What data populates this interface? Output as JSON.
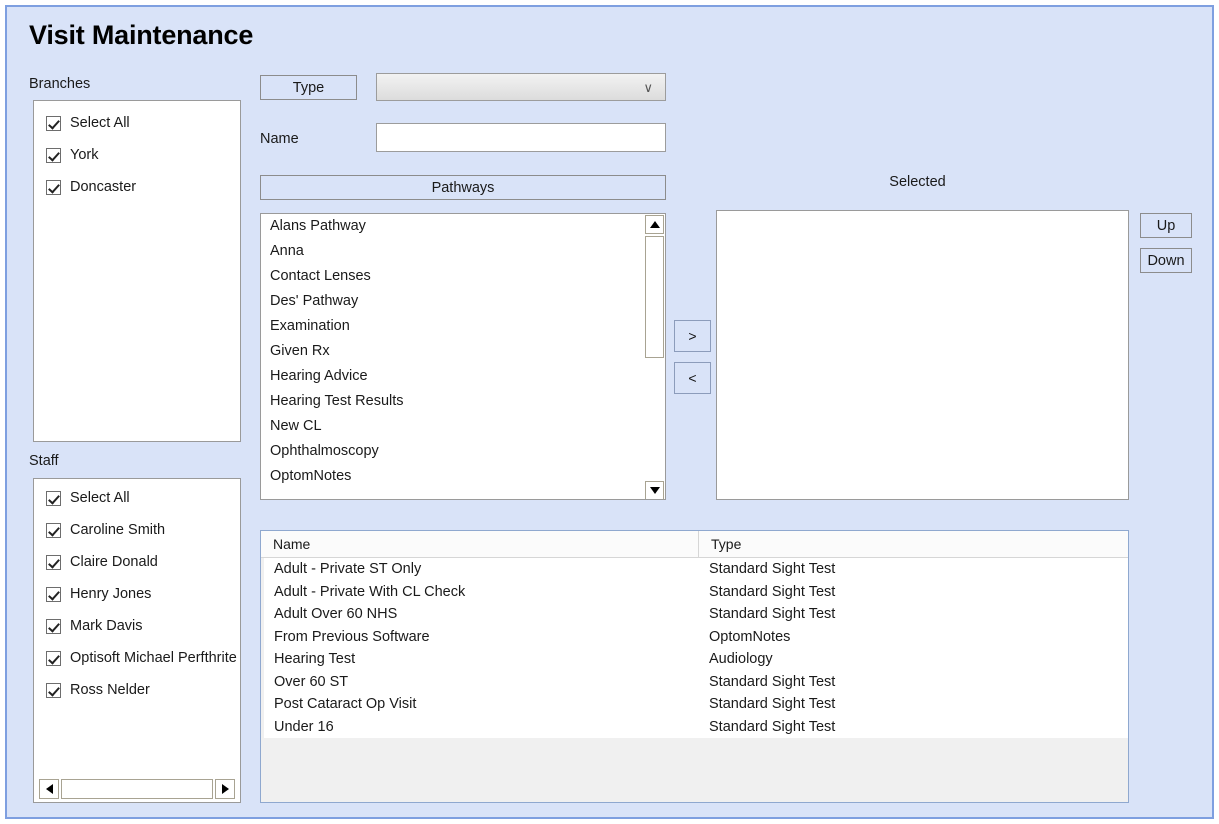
{
  "window": {
    "title": "Visit Maintenance",
    "accent_border": "#7e9fe0",
    "background": "#d9e3f8"
  },
  "branches": {
    "caption": "Branches",
    "items": [
      {
        "label": "Select All",
        "checked": true
      },
      {
        "label": "York",
        "checked": true
      },
      {
        "label": "Doncaster",
        "checked": true
      }
    ]
  },
  "staff": {
    "caption": "Staff",
    "items": [
      {
        "label": "Select All",
        "checked": true
      },
      {
        "label": "Caroline Smith",
        "checked": true
      },
      {
        "label": "Claire Donald",
        "checked": true
      },
      {
        "label": "Henry Jones",
        "checked": true
      },
      {
        "label": "Mark Davis",
        "checked": true
      },
      {
        "label": "Optisoft Michael Perfthrite",
        "checked": true
      },
      {
        "label": "Ross Nelder",
        "checked": true
      }
    ]
  },
  "type_row": {
    "button_label": "Type",
    "select_value": "",
    "chevron": "∨"
  },
  "name_row": {
    "label": "Name",
    "value": "",
    "placeholder": ""
  },
  "pathways": {
    "header_label": "Pathways",
    "items": [
      "Alans Pathway",
      "Anna",
      "Contact Lenses",
      "Des' Pathway",
      "Examination",
      "Given Rx",
      "Hearing Advice",
      "Hearing Test Results",
      "New CL",
      "Ophthalmoscopy",
      "OptomNotes"
    ]
  },
  "transfer": {
    "add_label": ">",
    "remove_label": "<"
  },
  "selected": {
    "caption": "Selected",
    "items": []
  },
  "reorder": {
    "up_label": "Up",
    "down_label": "Down"
  },
  "grid": {
    "columns": [
      "Name",
      "Type"
    ],
    "rows": [
      {
        "name": "Adult - Private ST Only",
        "type": "Standard Sight Test"
      },
      {
        "name": "Adult - Private With CL Check",
        "type": "Standard Sight Test"
      },
      {
        "name": "Adult Over 60 NHS",
        "type": "Standard Sight Test"
      },
      {
        "name": "From Previous Software",
        "type": "OptomNotes"
      },
      {
        "name": "Hearing Test",
        "type": "Audiology"
      },
      {
        "name": "Over 60 ST",
        "type": "Standard Sight Test"
      },
      {
        "name": "Post Cataract Op Visit",
        "type": "Standard Sight Test"
      },
      {
        "name": "Under 16",
        "type": "Standard Sight Test"
      }
    ]
  }
}
